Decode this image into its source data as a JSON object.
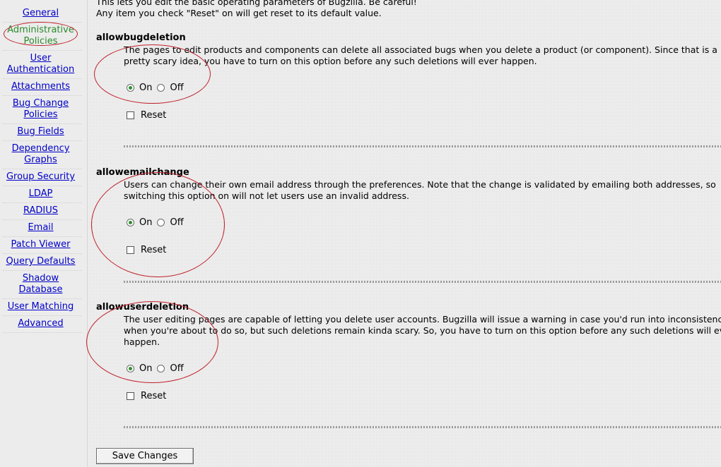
{
  "sidebar": {
    "items": [
      {
        "label": "General",
        "active": false
      },
      {
        "label": "Administrative\nPolicies",
        "active": true
      },
      {
        "label": "User\nAuthentication",
        "active": false
      },
      {
        "label": "Attachments",
        "active": false
      },
      {
        "label": "Bug Change\nPolicies",
        "active": false
      },
      {
        "label": "Bug Fields",
        "active": false
      },
      {
        "label": "Dependency\nGraphs",
        "active": false
      },
      {
        "label": "Group Security",
        "active": false
      },
      {
        "label": "LDAP",
        "active": false
      },
      {
        "label": "RADIUS",
        "active": false
      },
      {
        "label": "Email",
        "active": false
      },
      {
        "label": "Patch Viewer",
        "active": false
      },
      {
        "label": "Query Defaults",
        "active": false
      },
      {
        "label": "Shadow\nDatabase",
        "active": false
      },
      {
        "label": "User Matching",
        "active": false
      },
      {
        "label": "Advanced",
        "active": false
      }
    ]
  },
  "intro": {
    "line1": "This lets you edit the basic operating parameters of Bugzilla. Be careful!",
    "line2": "Any item you check \"Reset\" on will get reset to its default value."
  },
  "params": [
    {
      "name": "allowbugdeletion",
      "description": "The pages to edit products and components can delete all associated bugs when you delete a product (or component). Since that is a pretty scary idea, you have to turn on this option before any such deletions will ever happen.",
      "on_label": "On",
      "off_label": "Off",
      "selected": "On",
      "reset_label": "Reset",
      "reset_checked": false
    },
    {
      "name": "allowemailchange",
      "description": "Users can change their own email address through the preferences. Note that the change is validated by emailing both addresses, so switching this option on will not let users use an invalid address.",
      "on_label": "On",
      "off_label": "Off",
      "selected": "On",
      "reset_label": "Reset",
      "reset_checked": false
    },
    {
      "name": "allowuserdeletion",
      "description": "The user editing pages are capable of letting you delete user accounts. Bugzilla will issue a warning in case you'd run into inconsistencies when you're about to do so, but such deletions remain kinda scary. So, you have to turn on this option before any such deletions will ever happen.",
      "on_label": "On",
      "off_label": "Off",
      "selected": "On",
      "reset_label": "Reset",
      "reset_checked": false
    }
  ],
  "save_button": {
    "label": "Save Changes"
  },
  "colors": {
    "link": "#0000c8",
    "active_link": "#2a8a2a",
    "annotation": "#c0202a"
  }
}
